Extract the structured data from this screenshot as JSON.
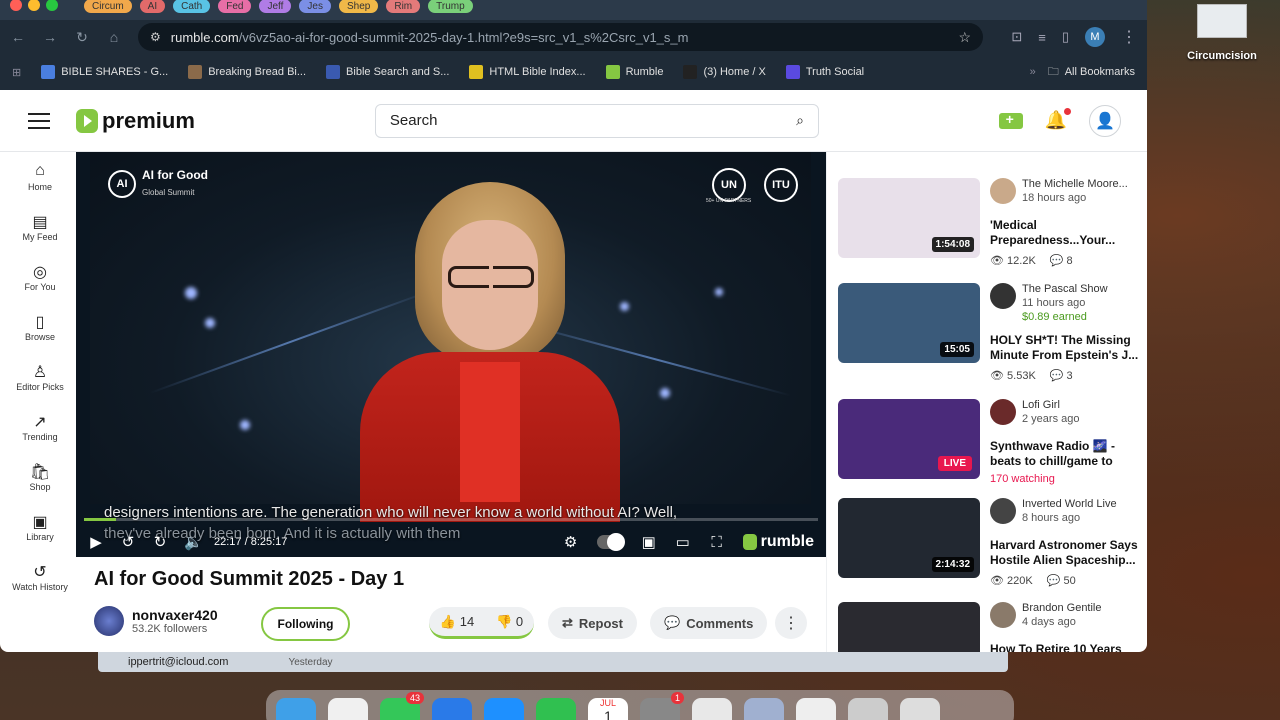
{
  "desktop": {
    "icon_label": "Circumcision"
  },
  "browser": {
    "tabs": [
      {
        "label": "Circum",
        "color": "#f1a84b"
      },
      {
        "label": "AI",
        "color": "#e26a6a"
      },
      {
        "label": "Cath",
        "color": "#59c3e5"
      },
      {
        "label": "Fed",
        "color": "#e76ea6"
      },
      {
        "label": "Jeff",
        "color": "#b07ce6"
      },
      {
        "label": "Jes",
        "color": "#7b8fe6"
      },
      {
        "label": "Shep",
        "color": "#f0b848"
      },
      {
        "label": "Rim",
        "color": "#e47a7a"
      },
      {
        "label": "Trump",
        "color": "#7ad07a"
      }
    ],
    "url_host": "rumble.com",
    "url_path": "/v6vz5ao-ai-for-good-summit-2025-day-1.html?e9s=src_v1_s%2Csrc_v1_s_m",
    "profile_initial": "M",
    "bookmarks": [
      {
        "label": "BIBLE SHARES - G...",
        "color": "#4a7fe0"
      },
      {
        "label": "Breaking Bread Bi...",
        "color": "#8a6a4a"
      },
      {
        "label": "Bible Search and S...",
        "color": "#3a5ab0"
      },
      {
        "label": "HTML Bible Index...",
        "color": "#e0c020"
      },
      {
        "label": "Rumble",
        "color": "#85c742"
      },
      {
        "label": "(3) Home / X",
        "color": "#222222"
      },
      {
        "label": "Truth Social",
        "color": "#5a4ae0"
      }
    ],
    "bookmarks_overflow": "»",
    "all_bookmarks": "All Bookmarks"
  },
  "header": {
    "logo_text": "premium",
    "search_placeholder": "Search"
  },
  "leftnav": [
    {
      "label": "Home",
      "icon": "⌂"
    },
    {
      "label": "My Feed",
      "icon": "▤"
    },
    {
      "label": "For You",
      "icon": "◎"
    },
    {
      "label": "Browse",
      "icon": "▯"
    },
    {
      "label": "Editor Picks",
      "icon": "♙"
    },
    {
      "label": "Trending",
      "icon": "↗"
    },
    {
      "label": "Shop",
      "icon": "🛍"
    },
    {
      "label": "Library",
      "icon": "▣"
    },
    {
      "label": "Watch History",
      "icon": "↺"
    }
  ],
  "video": {
    "brand_title": "AI for Good",
    "brand_sub": "Global Summit",
    "un_label": "50+ UN PARTNERS",
    "itu_label": "ITU",
    "caption_line1": "designers intentions are. The generation who will never know a world without AI? Well,",
    "caption_line2": "they've already been born. And it is actually with them",
    "time": "22:17 / 8:25:17",
    "progress": 0.044,
    "watermark": "rumble",
    "title": "AI for Good Summit 2025 - Day 1",
    "channel": "nonvaxer420",
    "followers": "53.2K followers",
    "follow_label": "Following",
    "likes": "14",
    "dislikes": "0",
    "repost_label": "Repost",
    "comments_label": "Comments"
  },
  "related": [
    {
      "channel": "The Michelle Moore...",
      "ago": "18 hours ago",
      "title": "'Medical Preparedness...Your...",
      "duration": "1:54:08",
      "views": "12.2K",
      "comments": "8",
      "thumb": "#e8e0ea",
      "avatar": "#c9a98a"
    },
    {
      "channel": "The Pascal Show",
      "ago": "11 hours ago",
      "earned": "$0.89 earned",
      "title": "HOLY SH*T! The Missing Minute From Epstein's J...",
      "duration": "15:05",
      "views": "5.53K",
      "comments": "3",
      "thumb": "#3a5a7a",
      "avatar": "#333333"
    },
    {
      "channel": "Lofi Girl",
      "ago": "2 years ago",
      "title": "Synthwave Radio 🌌 - beats to chill/game to",
      "live": "LIVE",
      "watching": "170 watching",
      "thumb": "#4a2a7a",
      "avatar": "#6a2a2a"
    },
    {
      "channel": "Inverted World Live",
      "ago": "8 hours ago",
      "title": "Harvard Astronomer Says Hostile Alien Spaceship...",
      "duration": "2:14:32",
      "views": "220K",
      "comments": "50",
      "thumb": "#222831",
      "avatar": "#444444"
    },
    {
      "channel": "Brandon Gentile",
      "ago": "4 days ago",
      "title": "How To Retire 10 Years",
      "thumb": "#2a2a30",
      "avatar": "#8a7a6a"
    }
  ],
  "mail": {
    "from": "ippertrit@icloud.com",
    "when": "Yesterday"
  },
  "dock_badges": {
    "messages": "43",
    "settings": "1"
  },
  "dock_calendar": {
    "month": "JUL",
    "day": "1"
  }
}
